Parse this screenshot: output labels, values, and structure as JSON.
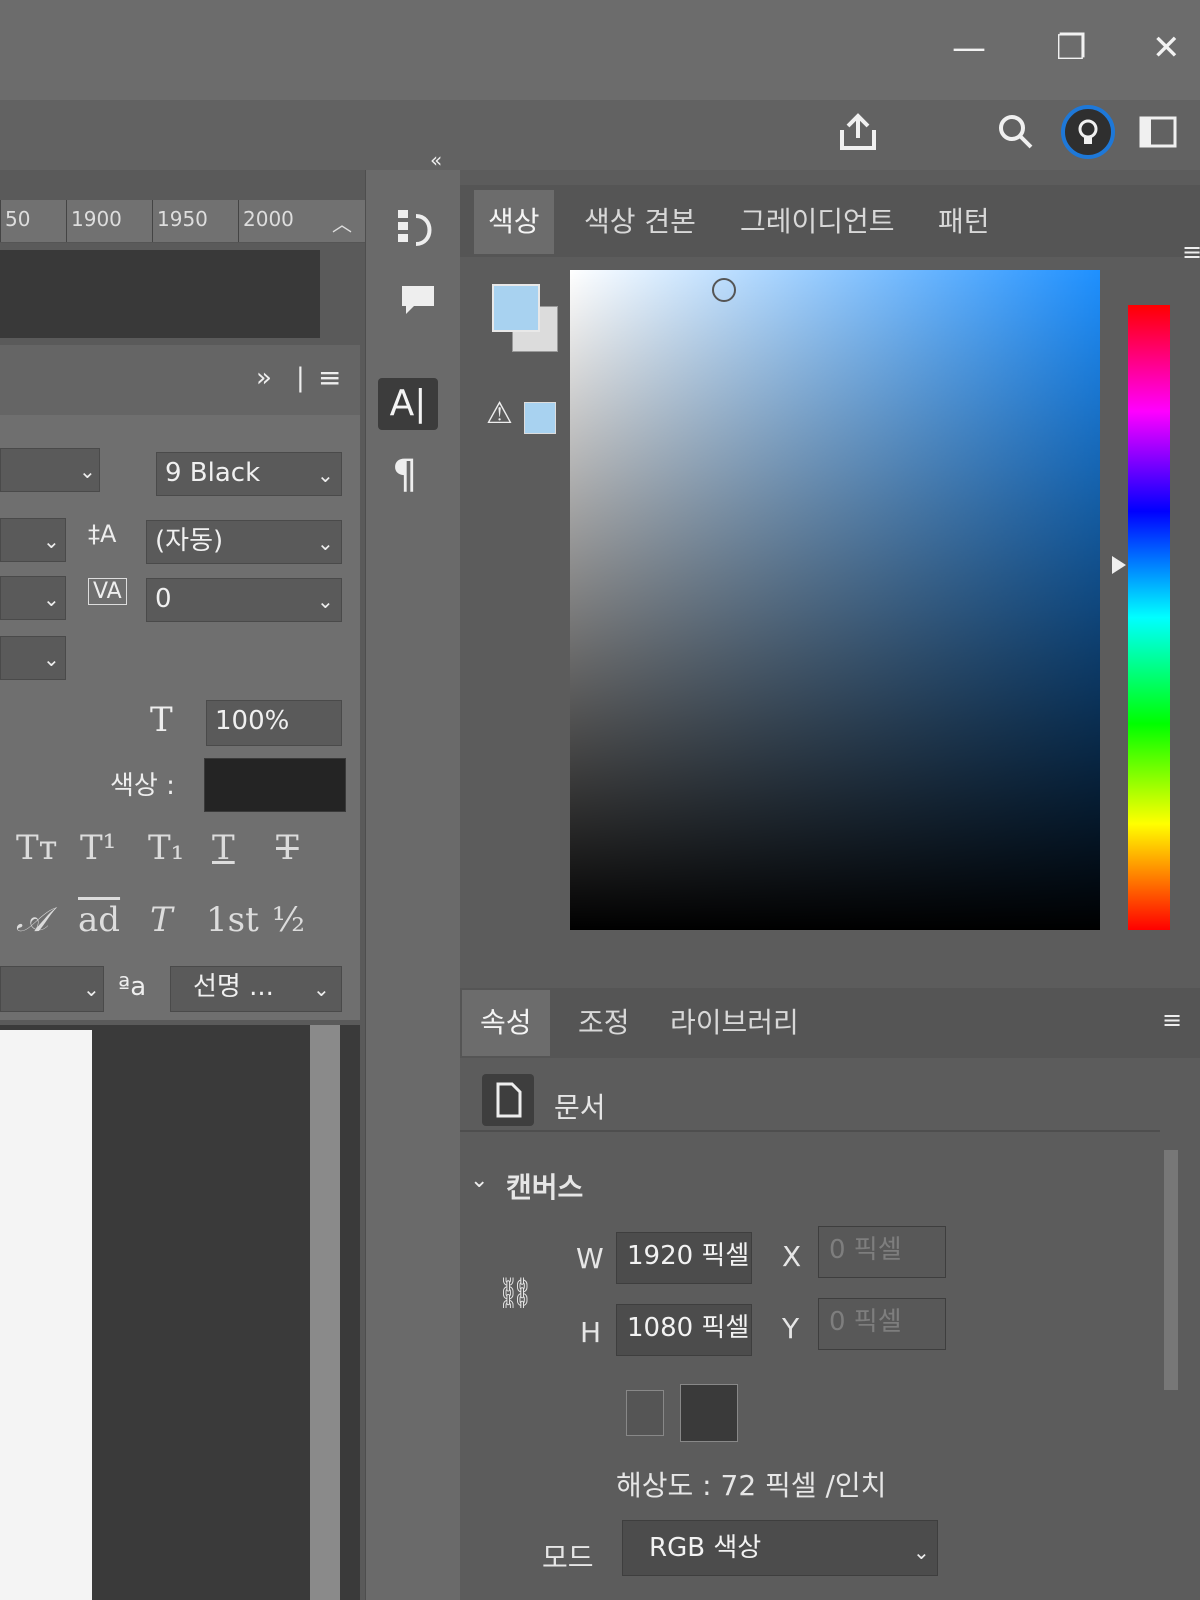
{
  "window_controls": {
    "minimize": "—",
    "restore": "❐",
    "close": "✕"
  },
  "ruler": {
    "ticks": [
      "50",
      "1900",
      "1950",
      "2000"
    ]
  },
  "character_panel": {
    "font_style": "9 Black",
    "leading": "(자동)",
    "tracking": "0",
    "horizontal_scale": "100%",
    "color_label": "색상 :",
    "typo_buttons": [
      "Tт",
      "T¹",
      "T₁",
      "T",
      "T"
    ],
    "opentype_buttons": [
      "𝒜",
      "ad",
      "T",
      "1st",
      "½"
    ],
    "aa_label": "ªa",
    "antialias": "선명 ..."
  },
  "color_panel": {
    "tabs": [
      "색상",
      "색상 견본",
      "그레이디언트",
      "패턴"
    ],
    "active_tab": "색상",
    "foreground_color": "#a8d2f0",
    "background_color": "#dcdcdc",
    "hue_color": "#1e90ff"
  },
  "properties_panel": {
    "tabs": [
      "속성",
      "조정",
      "라이브러리"
    ],
    "active_tab": "속성",
    "doc_label": "문서",
    "section_title": "캔버스",
    "w_label": "W",
    "w_value": "1920 픽셀",
    "h_label": "H",
    "h_value": "1080 픽셀",
    "x_label": "X",
    "x_placeholder": "0 픽셀",
    "y_label": "Y",
    "y_placeholder": "0 픽셀",
    "resolution": "해상도 : 72 픽셀 /인치",
    "mode_label": "모드",
    "mode_value": "RGB 색상"
  },
  "colors": {
    "accent_blue": "#1e78d8"
  }
}
